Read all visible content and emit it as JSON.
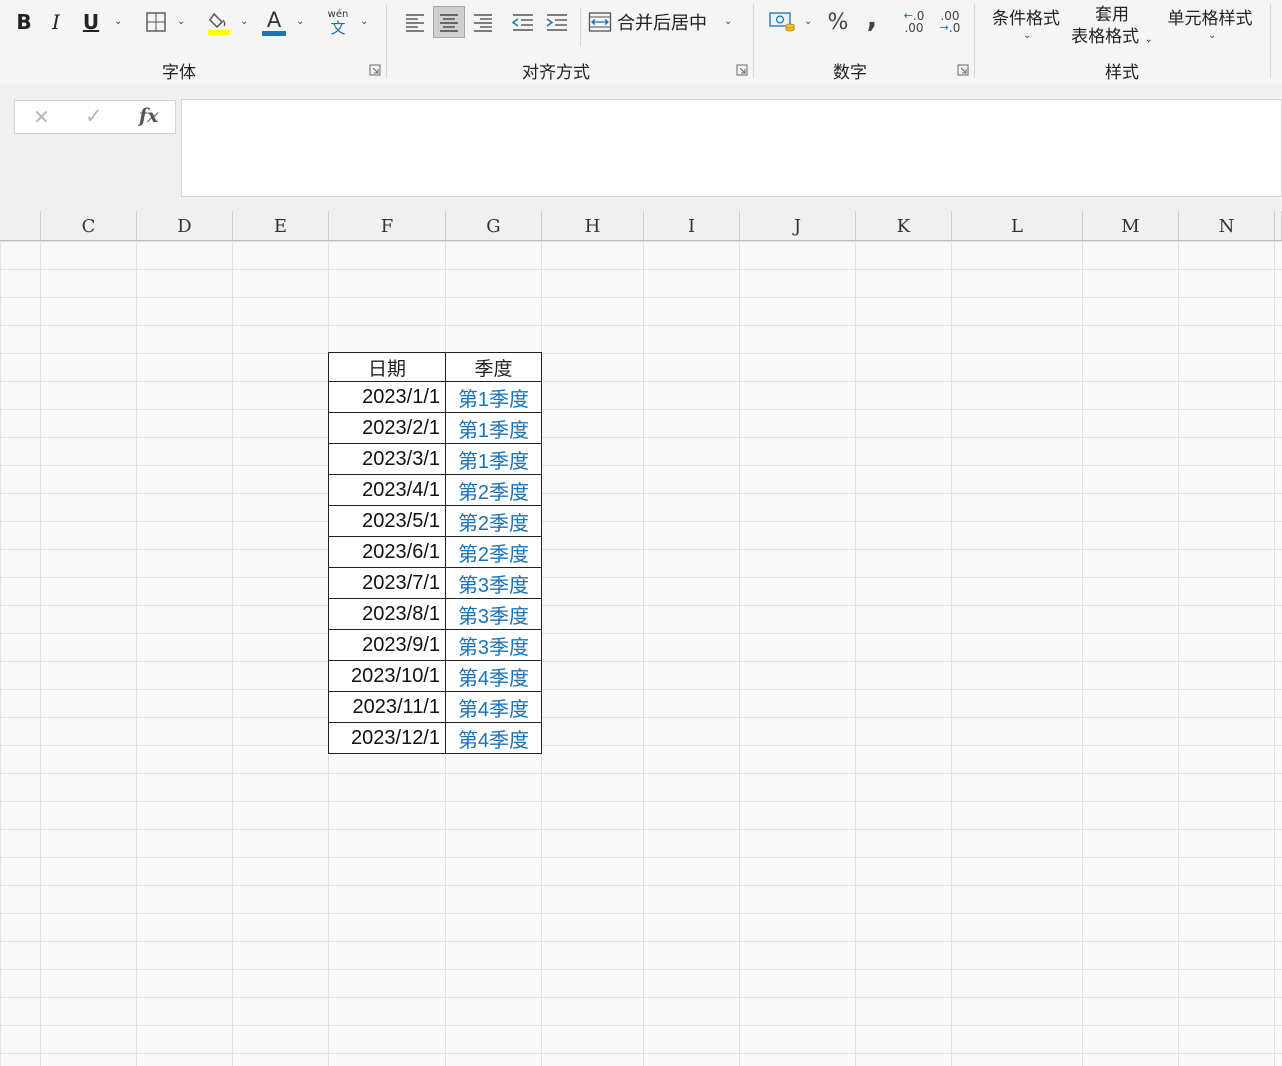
{
  "ribbon": {
    "font_group": {
      "label": "字体",
      "bold_label": "B",
      "italic_label": "I",
      "underline_label": "U",
      "phonetic_top": "wén",
      "phonetic_bottom": "文",
      "font_color_label": "A"
    },
    "align_group": {
      "label": "对齐方式",
      "merge_center_label": "合并后居中"
    },
    "number_group": {
      "label": "数字",
      "percent_label": "%",
      "comma_label": ",",
      "inc_decimal_top": ".0",
      "inc_decimal_bottom": ".00",
      "dec_decimal_top": ".00",
      "dec_decimal_bottom": ".0"
    },
    "styles_group": {
      "label": "样式",
      "conditional_format_label": "条件格式",
      "table_format_line1": "套用",
      "table_format_line2": "表格格式",
      "cell_styles_label": "单元格样式"
    }
  },
  "formula_bar": {
    "cancel_label": "✕",
    "enter_label": "✓",
    "fx_label": "fx",
    "value": ""
  },
  "columns": [
    "C",
    "D",
    "E",
    "F",
    "G",
    "H",
    "I",
    "J",
    "K",
    "L",
    "M",
    "N"
  ],
  "table": {
    "headers": [
      "日期",
      "季度"
    ],
    "rows": [
      [
        "2023/1/1",
        "第1季度"
      ],
      [
        "2023/2/1",
        "第1季度"
      ],
      [
        "2023/3/1",
        "第1季度"
      ],
      [
        "2023/4/1",
        "第2季度"
      ],
      [
        "2023/5/1",
        "第2季度"
      ],
      [
        "2023/6/1",
        "第2季度"
      ],
      [
        "2023/7/1",
        "第3季度"
      ],
      [
        "2023/8/1",
        "第3季度"
      ],
      [
        "2023/9/1",
        "第3季度"
      ],
      [
        "2023/10/1",
        "第4季度"
      ],
      [
        "2023/11/1",
        "第4季度"
      ],
      [
        "2023/12/1",
        "第4季度"
      ]
    ]
  },
  "colors": {
    "quarter_text": "#1a72b8",
    "highlight_yellow": "#ffff00",
    "font_color_blue": "#1a72b8"
  }
}
